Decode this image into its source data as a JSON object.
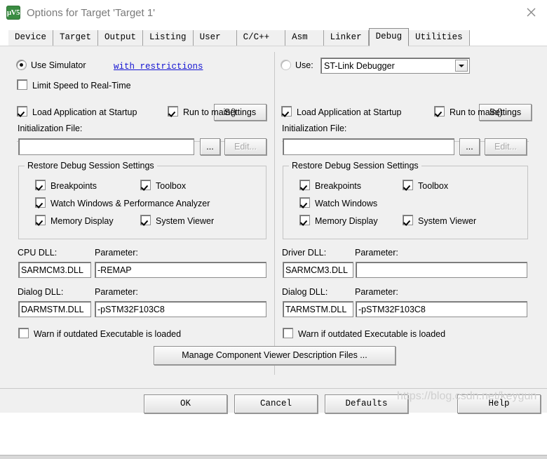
{
  "window": {
    "title": "Options for Target 'Target 1'",
    "icon": "uvision-icon",
    "icon_glyph": "µV5",
    "close_label": "✕",
    "icon_color": "#3a8c42",
    "title_color": "#7a7a7a"
  },
  "tabs": [
    {
      "label": "Device",
      "selected": false
    },
    {
      "label": "Target",
      "selected": false
    },
    {
      "label": "Output",
      "selected": false
    },
    {
      "label": "Listing",
      "selected": false
    },
    {
      "label": "User",
      "selected": false
    },
    {
      "label": "C/C++",
      "selected": false
    },
    {
      "label": "Asm",
      "selected": false
    },
    {
      "label": "Linker",
      "selected": false
    },
    {
      "label": "Debug",
      "selected": true
    },
    {
      "label": "Utilities",
      "selected": false
    }
  ],
  "left_pane": {
    "use_simulator": {
      "label": "Use Simulator",
      "checked": true,
      "link_label": "with restrictions",
      "link_color": "#1414d2"
    },
    "settings_button": "Settings",
    "limit_speed": {
      "label": "Limit Speed to Real-Time",
      "checked": false
    },
    "load_application": {
      "label": "Load Application at Startup",
      "checked": true
    },
    "run_to_main": {
      "label": "Run to main()",
      "checked": true
    },
    "init_file_label": "Initialization File:",
    "init_file_value": "",
    "browse_button": "...",
    "edit_button": "Edit...",
    "edit_button_enabled": false,
    "restore_group": {
      "title": "Restore Debug Session Settings",
      "items": [
        {
          "label": "Breakpoints",
          "checked": true
        },
        {
          "label": "Toolbox",
          "checked": true
        },
        {
          "label": "Watch Windows & Performance Analyzer",
          "checked": true
        },
        {
          "label": "Memory Display",
          "checked": true
        },
        {
          "label": "System Viewer",
          "checked": true
        }
      ]
    },
    "cpu_dll_label": "CPU DLL:",
    "cpu_dll_value": "SARMCM3.DLL",
    "cpu_param_label": "Parameter:",
    "cpu_param_value": "-REMAP",
    "dialog_dll_label": "Dialog DLL:",
    "dialog_dll_value": "DARMSTM.DLL",
    "dialog_param_label": "Parameter:",
    "dialog_param_value": "-pSTM32F103C8",
    "warn_outdated": {
      "label": "Warn if outdated Executable is loaded",
      "checked": false
    }
  },
  "right_pane": {
    "use_driver": {
      "label": "Use:",
      "checked": false
    },
    "driver_selected": "ST-Link Debugger",
    "driver_options": [
      "ST-Link Debugger"
    ],
    "settings_button": "Settings",
    "load_application": {
      "label": "Load Application at Startup",
      "checked": true
    },
    "run_to_main": {
      "label": "Run to main()",
      "checked": true
    },
    "init_file_label": "Initialization File:",
    "init_file_value": "",
    "browse_button": "...",
    "edit_button": "Edit...",
    "edit_button_enabled": false,
    "restore_group": {
      "title": "Restore Debug Session Settings",
      "items": [
        {
          "label": "Breakpoints",
          "checked": true
        },
        {
          "label": "Toolbox",
          "checked": true
        },
        {
          "label": "Watch Windows",
          "checked": true
        },
        {
          "label": "Memory Display",
          "checked": true
        },
        {
          "label": "System Viewer",
          "checked": true
        }
      ]
    },
    "driver_dll_label": "Driver DLL:",
    "driver_dll_value": "SARMCM3.DLL",
    "driver_param_label": "Parameter:",
    "driver_param_value": "",
    "dialog_dll_label": "Dialog DLL:",
    "dialog_dll_value": "TARMSTM.DLL",
    "dialog_param_label": "Parameter:",
    "dialog_param_value": "-pSTM32F103C8",
    "warn_outdated": {
      "label": "Warn if outdated Executable is loaded",
      "checked": false
    }
  },
  "manage_button": "Manage Component Viewer Description Files ...",
  "footer": {
    "ok": "OK",
    "cancel": "Cancel",
    "defaults": "Defaults",
    "help": "Help"
  },
  "watermark": "https://blog.csdn.net/keygun"
}
